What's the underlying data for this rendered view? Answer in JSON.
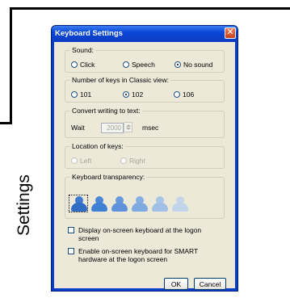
{
  "slide": {
    "side_label": "Settings"
  },
  "window": {
    "title": "Keyboard Settings",
    "close_glyph": "✕"
  },
  "sound": {
    "label": "Sound:",
    "options": [
      "Click",
      "Speech",
      "No sound"
    ],
    "selected": "No sound"
  },
  "keys": {
    "label": "Number of keys in Classic view:",
    "options": [
      "101",
      "102",
      "106"
    ],
    "selected": "102"
  },
  "convert": {
    "label": "Convert writing to text:",
    "wait_label": "Wait",
    "value": "2000",
    "unit": "msec"
  },
  "location": {
    "label": "Location of keys:",
    "options": [
      "Left",
      "Right"
    ]
  },
  "transparency": {
    "label": "Keyboard transparency:",
    "levels": 6,
    "selected_level": 1
  },
  "checkboxes": [
    {
      "label": "Display on-screen keyboard at the logon screen",
      "checked": false
    },
    {
      "label": "Enable on-screen keyboard for SMART hardware at the logon screen",
      "checked": false
    }
  ],
  "buttons": {
    "ok": "OK",
    "cancel": "Cancel"
  }
}
